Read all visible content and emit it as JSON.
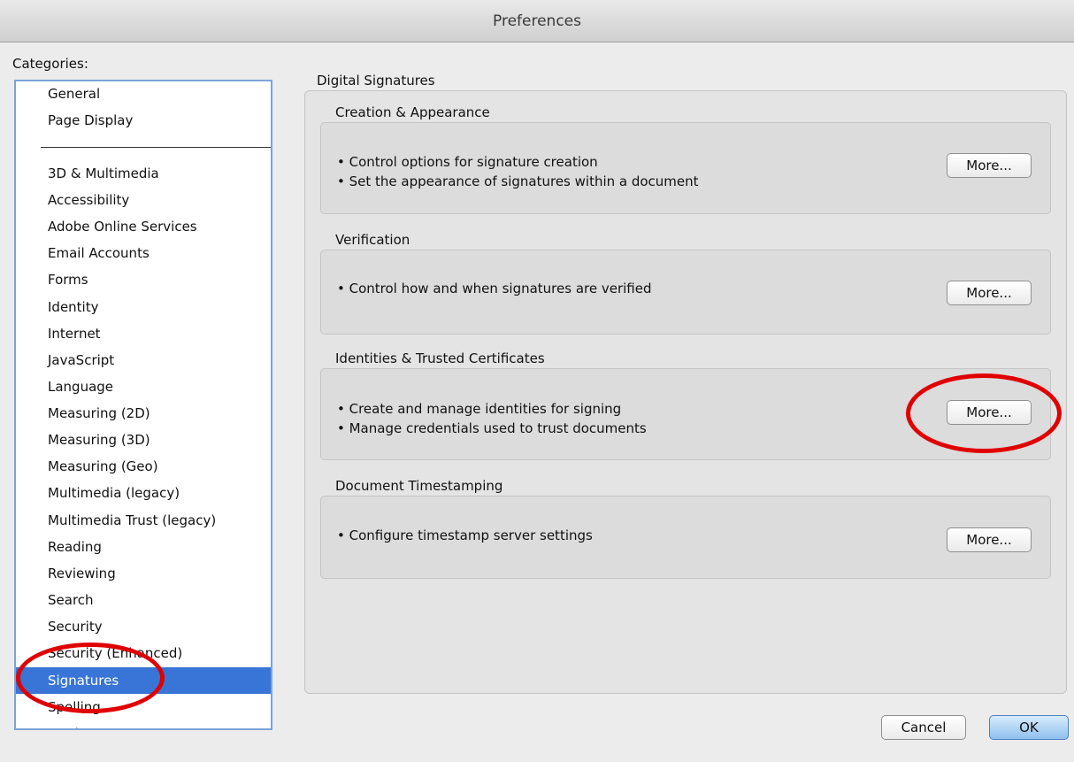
{
  "window": {
    "title": "Preferences"
  },
  "categories": {
    "label": "Categories:",
    "items": [
      "General",
      "Page Display",
      "3D & Multimedia",
      "Accessibility",
      "Adobe Online Services",
      "Email Accounts",
      "Forms",
      "Identity",
      "Internet",
      "JavaScript",
      "Language",
      "Measuring (2D)",
      "Measuring (3D)",
      "Measuring (Geo)",
      "Multimedia (legacy)",
      "Multimedia Trust (legacy)",
      "Reading",
      "Reviewing",
      "Search",
      "Security",
      "Security (Enhanced)",
      "Signatures",
      "Spelling",
      "Tracker"
    ],
    "selected": "Signatures"
  },
  "panel": {
    "title": "Digital Signatures",
    "sections": [
      {
        "title": "Creation & Appearance",
        "bullets": [
          "• Control options for signature creation",
          "• Set the appearance of signatures within a document"
        ],
        "button": "More..."
      },
      {
        "title": "Verification",
        "bullets": [
          "• Control how and when signatures are verified"
        ],
        "button": "More..."
      },
      {
        "title": "Identities & Trusted Certificates",
        "bullets": [
          "• Create and manage identities for signing",
          "• Manage credentials used to trust documents"
        ],
        "button": "More..."
      },
      {
        "title": "Document Timestamping",
        "bullets": [
          "• Configure timestamp server settings"
        ],
        "button": "More..."
      }
    ]
  },
  "footer": {
    "cancel": "Cancel",
    "ok": "OK"
  },
  "colors": {
    "selection": "#3875d7",
    "annotation": "#e00000",
    "ok_button": "#8fc0ee"
  }
}
